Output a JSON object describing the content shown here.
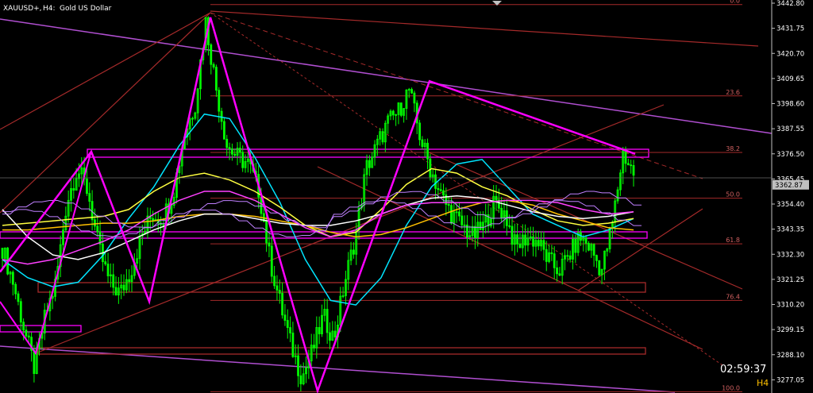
{
  "header": {
    "symbol": "XAUUSD+,",
    "timeframe": "H4:",
    "description": "Gold US Dollar"
  },
  "current_price": "3362.87",
  "countdown": "02:59:37",
  "timeframe_badge": "H4",
  "colors": {
    "background": "#000000",
    "candle": "#00ff00",
    "price_label_bg": "#c0c0c0",
    "fib": "#a52a2a",
    "zigzag": "#ff00ff",
    "channel_violet": "#b04fd0",
    "ma_cyan": "#00e5ff",
    "ma_yellow": "#ffff40",
    "ma_gold": "#ffc000",
    "ma_white": "#ffffff",
    "ma_magenta": "#ff40ff",
    "ma_lavender": "#c080ff",
    "countdown": "#ffffff",
    "badge": "#ffc000"
  },
  "chart_data": {
    "type": "candlestick",
    "title": "XAUUSD+, H4: Gold US Dollar",
    "ylim": [
      3271.6,
      3442.8
    ],
    "y_ticks": [
      "3442.80",
      "3431.75",
      "3420.70",
      "3409.65",
      "3398.60",
      "3387.55",
      "3376.50",
      "3365.45",
      "3354.40",
      "3343.35",
      "3332.30",
      "3321.25",
      "3310.20",
      "3299.15",
      "3288.10",
      "3277.05"
    ],
    "fib_levels": [
      {
        "label": "0.0",
        "price": 3442.2
      },
      {
        "label": "23.6",
        "price": 3402.0
      },
      {
        "label": "38.2",
        "price": 3377.1
      },
      {
        "label": "50.0",
        "price": 3357.0
      },
      {
        "label": "61.8",
        "price": 3336.9
      },
      {
        "label": "76.4",
        "price": 3312.0
      },
      {
        "label": "100.0",
        "price": 3271.8
      }
    ],
    "zigzag": [
      3324.5,
      3377.5,
      3311.5,
      3436.5,
      3272.2,
      3408.5,
      3376.5
    ],
    "close_path": [
      3335,
      3320,
      3300,
      3282,
      3305,
      3320,
      3355,
      3370,
      3360,
      3335,
      3320,
      3315,
      3325,
      3340,
      3350,
      3348,
      3360,
      3385,
      3398,
      3435,
      3405,
      3380,
      3375,
      3372,
      3360,
      3330,
      3310,
      3292,
      3278,
      3290,
      3305,
      3295,
      3320,
      3340,
      3370,
      3380,
      3390,
      3395,
      3405,
      3385,
      3370,
      3358,
      3350,
      3345,
      3340,
      3345,
      3355,
      3350,
      3335,
      3340,
      3338,
      3330,
      3325,
      3332,
      3340,
      3335,
      3325,
      3345,
      3377,
      3368
    ],
    "moving_averages": [
      {
        "color": "cyan",
        "values": [
          3330,
          3322,
          3318,
          3320,
          3332,
          3348,
          3362,
          3380,
          3394,
          3392,
          3375,
          3355,
          3330,
          3312,
          3310,
          3322,
          3345,
          3362,
          3372,
          3374,
          3362,
          3350,
          3345,
          3340,
          3343,
          3348
        ]
      },
      {
        "color": "yellow",
        "values": [
          3345,
          3346,
          3347,
          3348,
          3349,
          3352,
          3360,
          3366,
          3368,
          3365,
          3360,
          3353,
          3345,
          3340,
          3342,
          3352,
          3363,
          3370,
          3368,
          3362,
          3358,
          3352,
          3347,
          3345,
          3346,
          3348
        ]
      },
      {
        "color": "gold",
        "values": [
          3343,
          3343,
          3344,
          3345,
          3346,
          3346,
          3347,
          3349,
          3350,
          3350,
          3349,
          3347,
          3345,
          3342,
          3340,
          3341,
          3344,
          3348,
          3352,
          3355,
          3356,
          3354,
          3350,
          3347,
          3344,
          3343
        ]
      },
      {
        "color": "white",
        "values": [
          3352,
          3340,
          3332,
          3330,
          3333,
          3338,
          3343,
          3347,
          3350,
          3350,
          3348,
          3346,
          3345,
          3345,
          3347,
          3350,
          3354,
          3357,
          3358,
          3357,
          3354,
          3351,
          3349,
          3348,
          3349,
          3351
        ]
      },
      {
        "color": "magenta",
        "values": [
          3330,
          3328,
          3330,
          3334,
          3338,
          3343,
          3350,
          3356,
          3360,
          3360,
          3356,
          3350,
          3344,
          3340,
          3343,
          3350,
          3354,
          3355,
          3355,
          3355,
          3356,
          3356,
          3355,
          3352,
          3350,
          3351
        ]
      }
    ]
  }
}
